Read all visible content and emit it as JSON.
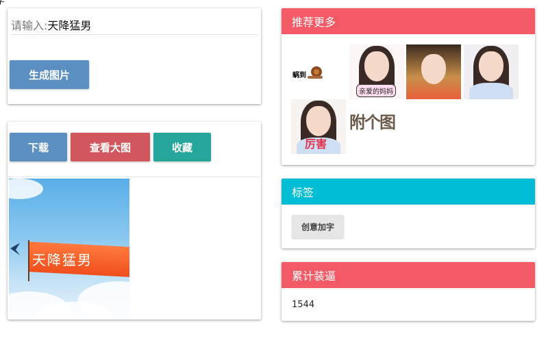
{
  "stray_text": "字",
  "input_card": {
    "placeholder": "请输入:",
    "value": "天降猛男",
    "generate_label": "生成图片"
  },
  "action_card": {
    "download_label": "下载",
    "view_label": "查看大图",
    "favorite_label": "收藏",
    "image_caption": "天降猛男"
  },
  "recommend": {
    "title": "推荐更多",
    "header_color": "#f25b66",
    "thumbs": [
      {
        "icon": "snail-meme-thumb",
        "text": "蜗到"
      },
      {
        "icon": "girl-meme-thumb",
        "text": "亲爱的妈妈"
      },
      {
        "icon": "butterfly-girl-thumb",
        "text": ""
      },
      {
        "icon": "girl-portrait-thumb",
        "text": ""
      },
      {
        "icon": "girl-thumbs-up-thumb",
        "text": "厉害"
      },
      {
        "icon": "glitch-text-thumb",
        "text": "附个图"
      }
    ]
  },
  "tags": {
    "title": "标签",
    "header_color": "#00bcd4",
    "chip": "创意加字"
  },
  "count": {
    "title": "累计装逼",
    "header_color": "#f25b66",
    "value": "1544"
  }
}
